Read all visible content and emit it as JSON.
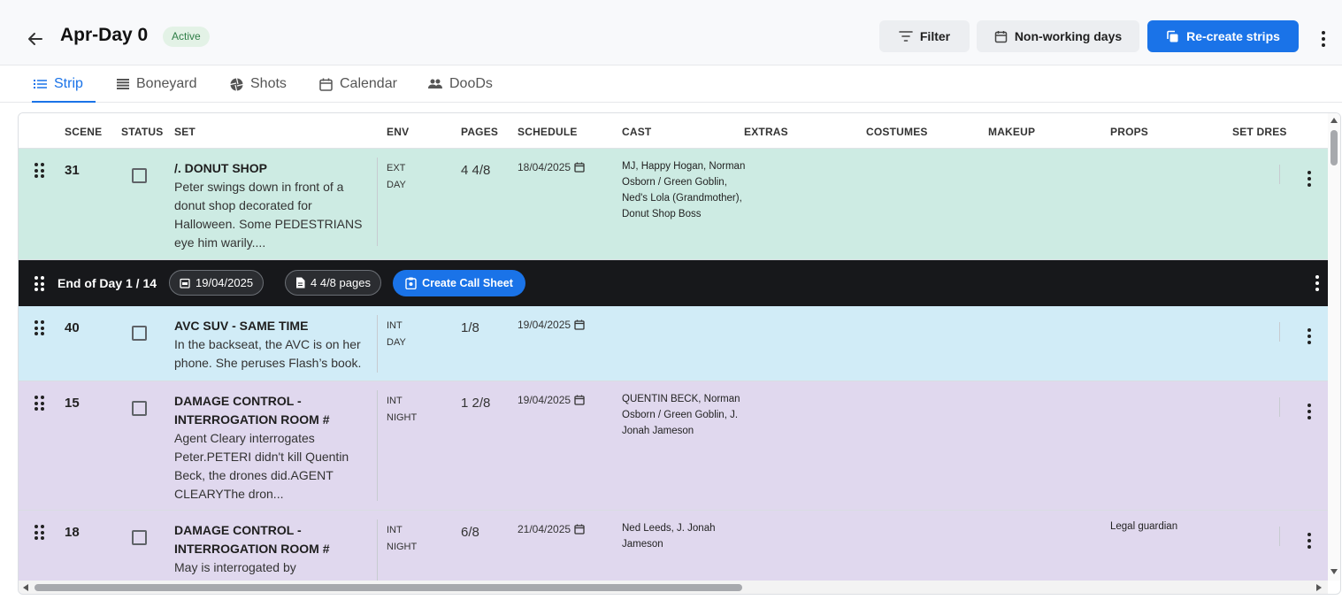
{
  "header": {
    "title": "Apr-Day 0",
    "status": "Active",
    "filter_label": "Filter",
    "nonworking_label": "Non-working days",
    "recreate_label": "Re-create strips"
  },
  "tabs": [
    {
      "label": "Strip",
      "icon": "list-icon",
      "active": true
    },
    {
      "label": "Boneyard",
      "icon": "stack-icon",
      "active": false
    },
    {
      "label": "Shots",
      "icon": "camera-shutter-icon",
      "active": false
    },
    {
      "label": "Calendar",
      "icon": "calendar-icon",
      "active": false
    },
    {
      "label": "DooDs",
      "icon": "people-icon",
      "active": false
    }
  ],
  "columns": [
    "SCENE",
    "STATUS",
    "SET",
    "ENV",
    "PAGES",
    "SCHEDULE",
    "CAST",
    "EXTRAS",
    "COSTUMES",
    "MAKEUP",
    "PROPS",
    "SET DRES"
  ],
  "rows": [
    {
      "scene": "31",
      "set_title": "/. DONUT SHOP",
      "set_desc": "Peter swings down in front of a donut shop decorated for Halloween. Some PEDESTRIANS eye him warily....",
      "env_type": "EXT",
      "env_time": "DAY",
      "pages": "4 4/8",
      "schedule": "18/04/2025",
      "cast": "MJ, Happy Hogan, Norman Osborn / Green Goblin, Ned's Lola (Grandmother), Donut Shop Boss",
      "props": "",
      "color": "#cdebe3"
    },
    {
      "scene": "40",
      "set_title": "AVC SUV - SAME TIME",
      "set_desc": "In the backseat, the AVC is on her phone. She peruses Flash’s book.",
      "env_type": "INT",
      "env_time": "DAY",
      "pages": "1/8",
      "schedule": "19/04/2025",
      "cast": "",
      "props": "",
      "color": "#d1ecf7"
    },
    {
      "scene": "15",
      "set_title": "DAMAGE CONTROL - INTERROGATION ROOM #",
      "set_desc": "Agent Cleary interrogates Peter.PETERI didn't kill Quentin Beck, the drones did.AGENT CLEARYThe dron...",
      "env_type": "INT",
      "env_time": "NIGHT",
      "pages": "1 2/8",
      "schedule": "19/04/2025",
      "cast": "QUENTIN BECK, Norman Osborn / Green Goblin, J. Jonah Jameson",
      "props": "",
      "color": "#e0d8ee"
    },
    {
      "scene": "18",
      "set_title": "DAMAGE CONTROL - INTERROGATION ROOM #",
      "set_desc": "May is interrogated by",
      "env_type": "INT",
      "env_time": "NIGHT",
      "pages": "6/8",
      "schedule": "21/04/2025",
      "cast": "Ned Leeds, J. Jonah Jameson",
      "props": "Legal guardian",
      "color": "#e0d8ee"
    }
  ],
  "end_of_day": {
    "label": "End of Day 1 / 14",
    "date": "19/04/2025",
    "pages": "4 4/8 pages",
    "call_sheet_label": "Create Call Sheet"
  }
}
